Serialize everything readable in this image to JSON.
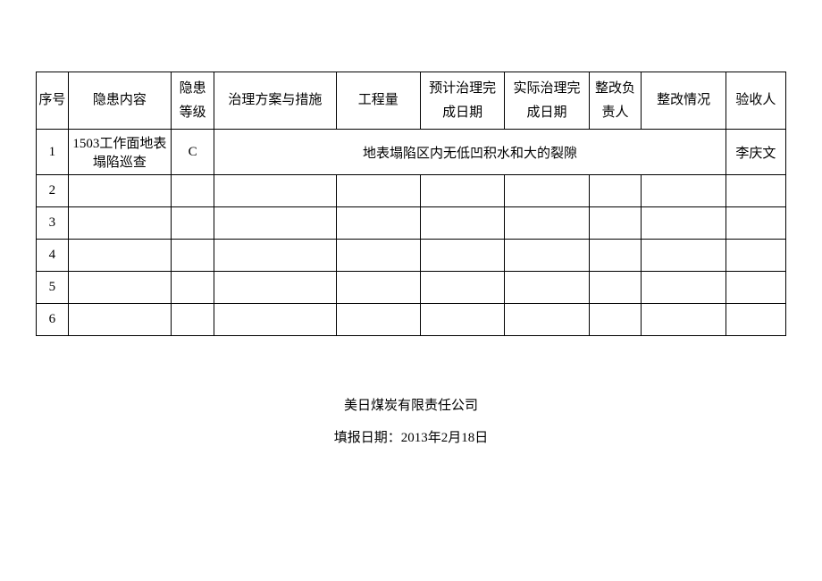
{
  "headers": {
    "seq": "序号",
    "content": "隐患内容",
    "level": "隐患等级",
    "plan": "治理方案与措施",
    "amount": "工程量",
    "plandate": "预计治理完成日期",
    "actualdate": "实际治理完成日期",
    "responsible": "整改负责人",
    "status": "整改情况",
    "acceptor": "验收人"
  },
  "rows": [
    {
      "seq": "1",
      "content": "1503工作面地表塌陷巡查",
      "level": "C",
      "merged_text": "地表塌陷区内无低凹积水和大的裂隙",
      "acceptor": "李庆文"
    },
    {
      "seq": "2"
    },
    {
      "seq": "3"
    },
    {
      "seq": "4"
    },
    {
      "seq": "5"
    },
    {
      "seq": "6"
    }
  ],
  "footer": {
    "company": "美日煤炭有限责任公司",
    "report_date_label": "填报日期：",
    "report_date": "2013年2月18日"
  }
}
